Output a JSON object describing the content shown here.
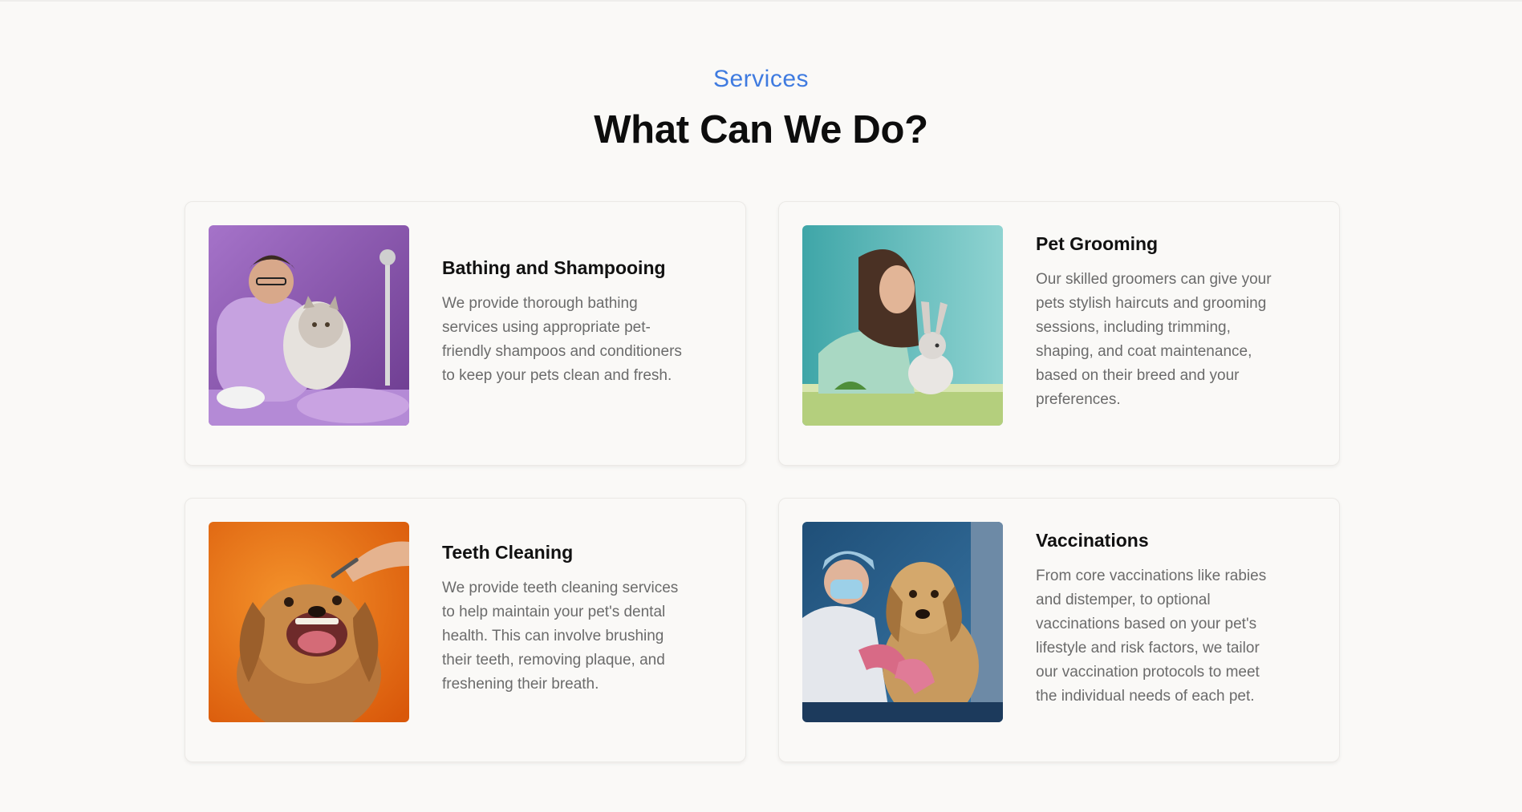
{
  "header": {
    "eyebrow": "Services",
    "title": "What Can We Do?"
  },
  "colors": {
    "accent": "#3f7be0",
    "background": "#faf9f7",
    "text_muted": "#6b6b6b"
  },
  "services": [
    {
      "title": "Bathing and Shampooing",
      "description": "We provide thorough bathing services using appropriate pet-friendly shampoos and conditioners to keep your pets clean and fresh.",
      "image_icon": "groomer-with-cat-photo"
    },
    {
      "title": "Pet Grooming",
      "description": "Our skilled groomers can give your pets stylish haircuts and grooming sessions, including trimming, shaping, and coat maintenance, based on their breed and your preferences.",
      "image_icon": "woman-with-rabbit-photo"
    },
    {
      "title": "Teeth Cleaning",
      "description": "We provide teeth cleaning services to help maintain your pet's dental health. This can involve brushing their teeth, removing plaque, and freshening their breath.",
      "image_icon": "dog-teeth-cleaning-photo"
    },
    {
      "title": "Vaccinations",
      "description": "From core vaccinations like rabies and distemper, to optional vaccinations based on your pet's lifestyle and risk factors, we tailor our vaccination protocols to meet the individual needs of each pet.",
      "image_icon": "vet-vaccinating-dog-photo"
    }
  ]
}
